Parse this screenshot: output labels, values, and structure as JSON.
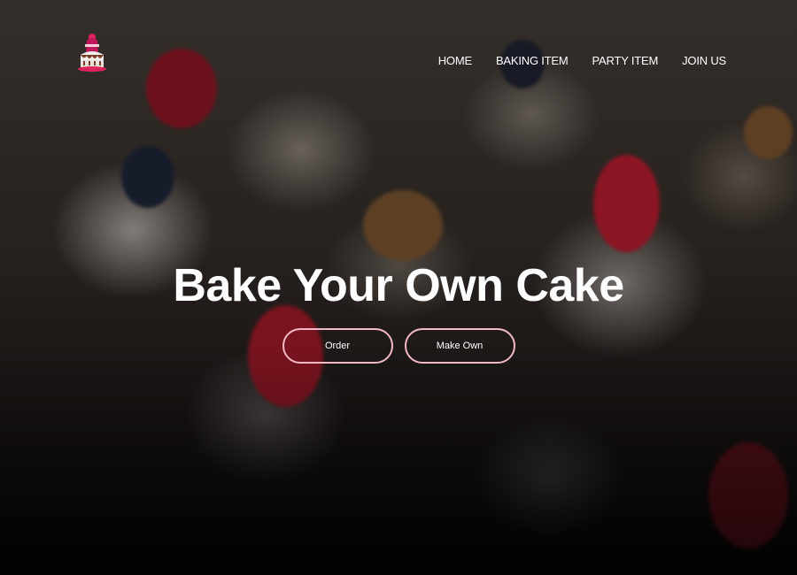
{
  "colors": {
    "button_border": "#f2b8c6",
    "text": "#ffffff",
    "logo_accent": "#e0245e"
  },
  "logo": {
    "icon": "cake-icon"
  },
  "nav": {
    "items": [
      {
        "label": "HOME"
      },
      {
        "label": "BAKING ITEM"
      },
      {
        "label": "PARTY ITEM"
      },
      {
        "label": "JOIN US"
      }
    ]
  },
  "hero": {
    "title": "Bake Your Own Cake",
    "buttons": {
      "order_label": "Order",
      "make_own_label": "Make Own"
    }
  }
}
